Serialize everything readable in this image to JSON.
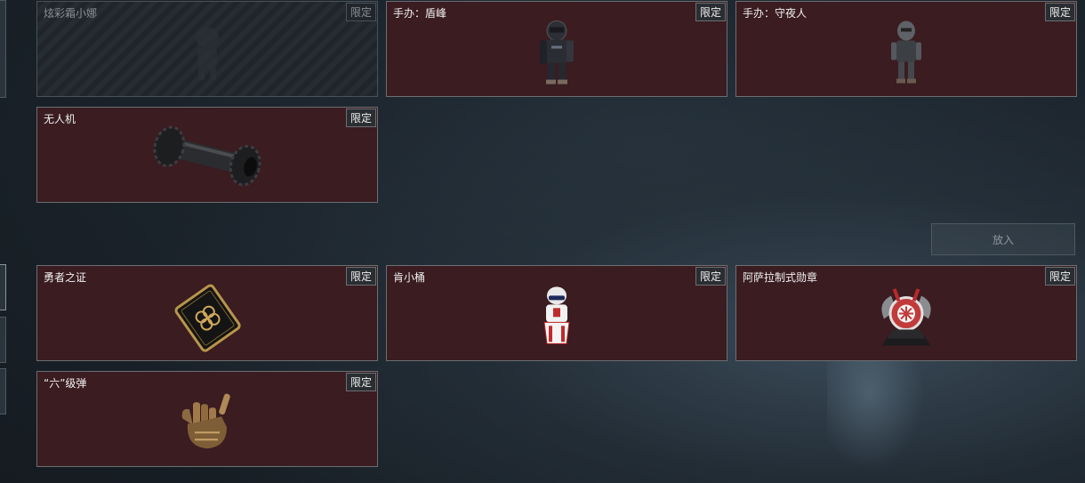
{
  "badge_label": "限定",
  "put_button_label": "放入",
  "cards_row1": [
    {
      "name": "炫彩霜小娜",
      "state": "disabled",
      "icon": "figure-silhouette-icon"
    },
    {
      "name": "手办：盾峰",
      "state": "active",
      "icon": "armored-figure-icon"
    },
    {
      "name": "手办：守夜人",
      "state": "active",
      "icon": "masked-figure-icon"
    }
  ],
  "cards_row2": [
    {
      "name": "无人机",
      "state": "active",
      "icon": "drone-roller-icon"
    }
  ],
  "cards_row3": [
    {
      "name": "勇者之证",
      "state": "active",
      "icon": "gold-card-icon"
    },
    {
      "name": "肯小桶",
      "state": "active",
      "icon": "bucket-figure-icon"
    },
    {
      "name": "阿萨拉制式勋章",
      "state": "active",
      "icon": "medal-icon"
    }
  ],
  "cards_row4": [
    {
      "name": "“六”级弹",
      "state": "active",
      "icon": "hand-gesture-icon"
    }
  ],
  "colors": {
    "card_bg": "#3a1c21",
    "card_border": "#6b6f73",
    "page_bg": "#1b232b"
  }
}
